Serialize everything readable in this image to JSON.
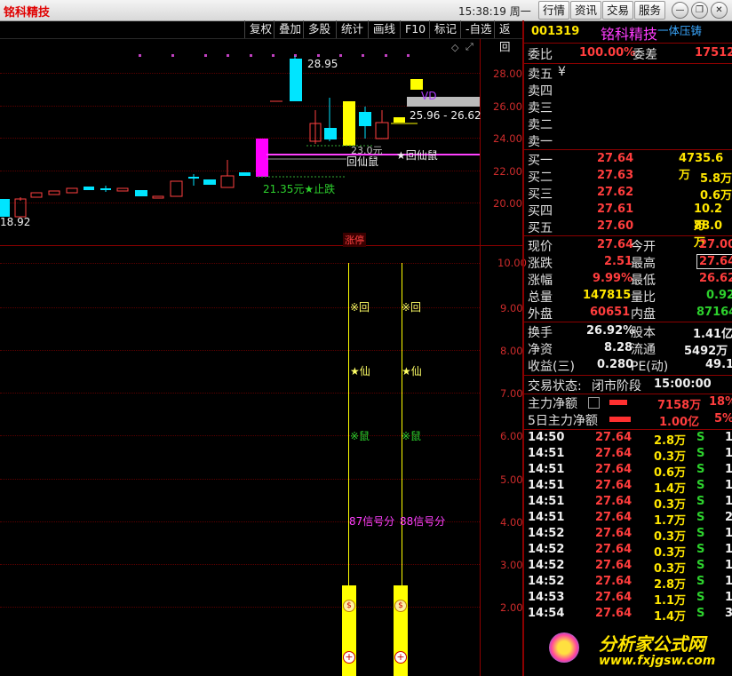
{
  "app": {
    "title": "铭科精技",
    "clock": "15:38:19 周一"
  },
  "top_buttons": [
    "行情",
    "资讯",
    "交易",
    "服务"
  ],
  "toolbar": [
    "复权",
    "叠加",
    "多股",
    "统计",
    "画线",
    "F10",
    "标记",
    "-自选",
    "返回"
  ],
  "kline": {
    "y_ticks": [
      "28.00",
      "26.00",
      "24.00",
      "22.00",
      "20.00"
    ],
    "labels": {
      "high": "28.95",
      "range": "25.96 - 26.62",
      "low_left": "18.92",
      "stop": "21.35元★止跌",
      "sig1": "回仙鼠",
      "sig2": "★回仙鼠",
      "price_tag": "23.0元",
      "vd": "VD"
    },
    "zt_tag": "涨停"
  },
  "indicator": {
    "y_ticks": [
      "10.00",
      "9.00",
      "8.00",
      "7.00",
      "6.00",
      "5.00",
      "4.00",
      "3.00",
      "2.00"
    ],
    "col1": {
      "hui": "※回",
      "xian": "★仙",
      "shu": "※鼠",
      "score": "87信号分"
    },
    "col2": {
      "hui": "※回",
      "xian": "★仙",
      "shu": "※鼠",
      "score": "88信号分"
    }
  },
  "panel": {
    "code": "001319",
    "name": "铭科精技",
    "tag": "一体压铸",
    "weibi_label": "委比",
    "weibi": "100.00%",
    "weicha_label": "委差",
    "weicha": "17512",
    "sell": [
      {
        "label": "卖五",
        "extra": "¥"
      },
      {
        "label": "卖四",
        "extra": ""
      },
      {
        "label": "卖三",
        "extra": ""
      },
      {
        "label": "卖二",
        "extra": ""
      },
      {
        "label": "卖一",
        "extra": ""
      }
    ],
    "buy": [
      {
        "label": "买一",
        "price": "27.64",
        "vol": "4735.6万"
      },
      {
        "label": "买二",
        "price": "27.63",
        "vol": "5.8万"
      },
      {
        "label": "买三",
        "price": "27.62",
        "vol": "0.6万"
      },
      {
        "label": "买四",
        "price": "27.61",
        "vol": "10.2万"
      },
      {
        "label": "买五",
        "price": "27.60",
        "vol": "88.0万"
      }
    ],
    "quote": [
      {
        "l1": "现价",
        "v1": "27.64",
        "c1": "red",
        "l2": "今开",
        "v2": "27.00",
        "c2": "red"
      },
      {
        "l1": "涨跌",
        "v1": "2.51",
        "c1": "red",
        "l2": "最高",
        "v2": "27.64",
        "c2": "red"
      },
      {
        "l1": "涨幅",
        "v1": "9.99%",
        "c1": "red",
        "l2": "最低",
        "v2": "26.62",
        "c2": "red"
      },
      {
        "l1": "总量",
        "v1": "147815",
        "c1": "yel",
        "l2": "量比",
        "v2": "0.92",
        "c2": "grn"
      },
      {
        "l1": "外盘",
        "v1": "60651",
        "c1": "red",
        "l2": "内盘",
        "v2": "87164",
        "c2": "grn"
      }
    ],
    "fund": [
      {
        "l1": "换手",
        "v1": "26.92%",
        "l2": "股本",
        "v2": "1.41亿"
      },
      {
        "l1": "净资",
        "v1": "8.28",
        "l2": "流通",
        "v2": "5492万"
      },
      {
        "l1": "收益(三)",
        "v1": "0.280",
        "l2": "PE(动)",
        "v2": "49.1"
      }
    ],
    "status_label": "交易状态:",
    "status_value": "闭市阶段",
    "status_time": "15:00:00",
    "main_flow": {
      "label": "主力净额",
      "value": "7158万",
      "pct": "18%"
    },
    "main_flow5": {
      "label": "5日主力净额",
      "value": "1.00亿",
      "pct": "5%"
    },
    "ticks": [
      {
        "t": "14:50",
        "p": "27.64",
        "v": "2.8万",
        "s": "S",
        "n": "1"
      },
      {
        "t": "14:51",
        "p": "27.64",
        "v": "0.3万",
        "s": "S",
        "n": "1"
      },
      {
        "t": "14:51",
        "p": "27.64",
        "v": "0.6万",
        "s": "S",
        "n": "1"
      },
      {
        "t": "14:51",
        "p": "27.64",
        "v": "1.4万",
        "s": "S",
        "n": "1"
      },
      {
        "t": "14:51",
        "p": "27.64",
        "v": "0.3万",
        "s": "S",
        "n": "1"
      },
      {
        "t": "14:51",
        "p": "27.64",
        "v": "1.7万",
        "s": "S",
        "n": "2"
      },
      {
        "t": "14:52",
        "p": "27.64",
        "v": "0.3万",
        "s": "S",
        "n": "1"
      },
      {
        "t": "14:52",
        "p": "27.64",
        "v": "0.3万",
        "s": "S",
        "n": "1"
      },
      {
        "t": "14:52",
        "p": "27.64",
        "v": "0.3万",
        "s": "S",
        "n": "1"
      },
      {
        "t": "14:52",
        "p": "27.64",
        "v": "2.8万",
        "s": "S",
        "n": "1"
      },
      {
        "t": "14:53",
        "p": "27.64",
        "v": "1.1万",
        "s": "S",
        "n": "1"
      },
      {
        "t": "14:54",
        "p": "27.64",
        "v": "1.4万",
        "s": "S",
        "n": "3"
      }
    ]
  },
  "watermark": {
    "text": "分析家公式网",
    "url": "www.fxjgsw.com"
  }
}
